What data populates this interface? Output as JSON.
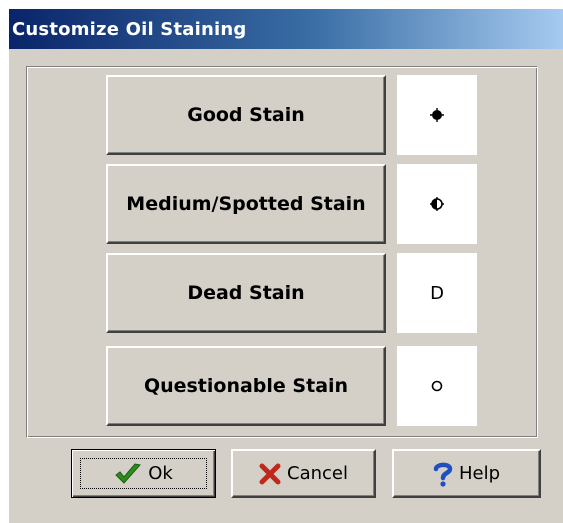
{
  "window": {
    "title": "Customize Oil Staining"
  },
  "stains": [
    {
      "label": "Good Stain",
      "symbol_icon": "filled-circle-icon",
      "symbol_text": ""
    },
    {
      "label": "Medium/Spotted Stain",
      "symbol_icon": "half-filled-circle-icon",
      "symbol_text": ""
    },
    {
      "label": "Dead Stain",
      "symbol_icon": "letter-d-symbol",
      "symbol_text": "D"
    },
    {
      "label": "Questionable Stain",
      "symbol_icon": "open-circle-icon",
      "symbol_text": ""
    }
  ],
  "buttons": {
    "ok": {
      "label": "Ok",
      "icon": "checkmark-icon",
      "icon_color": "#2e8b1e"
    },
    "cancel": {
      "label": "Cancel",
      "icon": "x-icon",
      "icon_color": "#c0281c"
    },
    "help": {
      "label": "Help",
      "icon": "question-mark-icon",
      "icon_color": "#1f4fc0"
    }
  },
  "colors": {
    "face": "#d4d0c8",
    "title_start": "#0a246a",
    "title_end": "#a6caf0"
  }
}
